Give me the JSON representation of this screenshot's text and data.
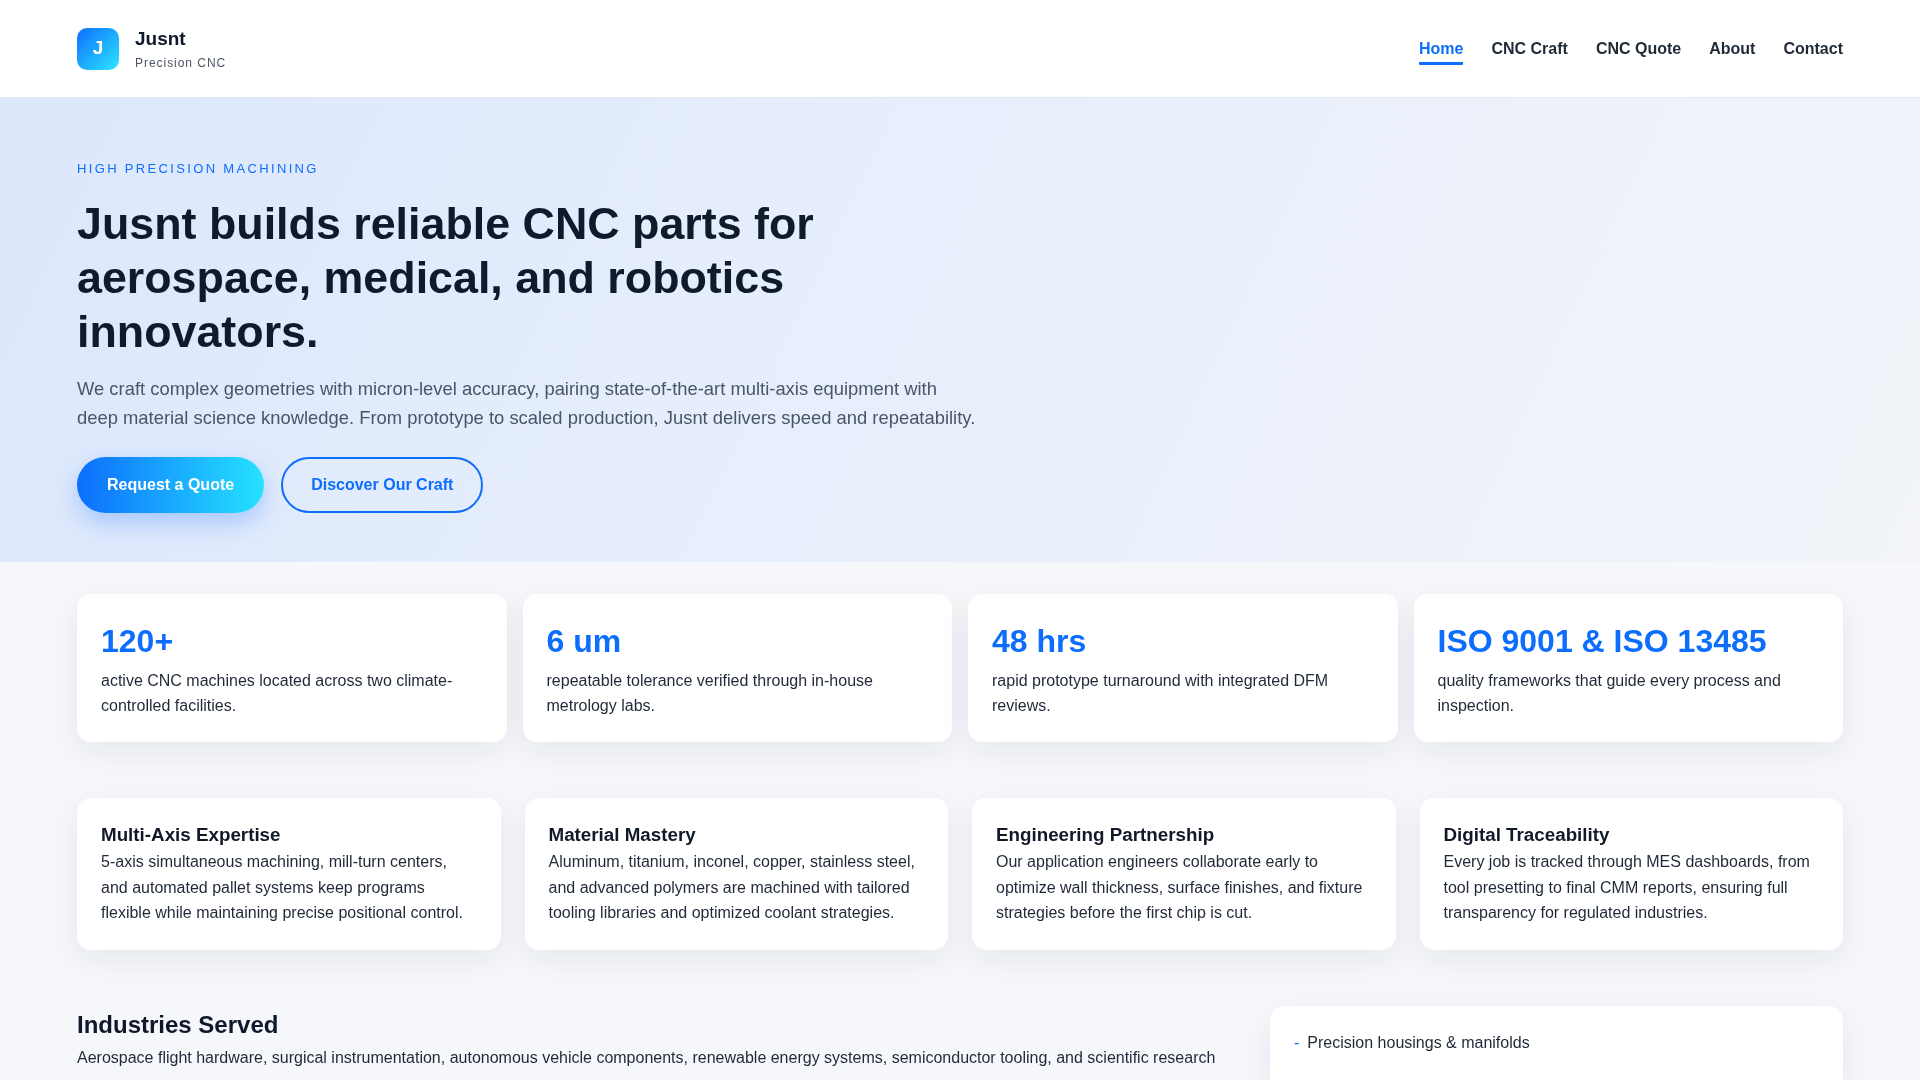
{
  "header": {
    "logo": {
      "letter": "J"
    },
    "brand": "Jusnt",
    "tagline": "Precision CNC",
    "nav": [
      {
        "label": "Home",
        "selected": true
      },
      {
        "label": "CNC Craft",
        "selected": false
      },
      {
        "label": "CNC Quote",
        "selected": false
      },
      {
        "label": "About",
        "selected": false
      },
      {
        "label": "Contact",
        "selected": false
      }
    ]
  },
  "hero": {
    "eyebrow": "HIGH PRECISION MACHINING",
    "title": "Jusnt builds reliable CNC parts for aerospace, medical, and robotics innovators.",
    "text": "We craft complex geometries with micron-level accuracy, pairing state-of-the-art multi-axis equipment with deep material science knowledge. From prototype to scaled production, Jusnt delivers speed and repeatability.",
    "buttons": [
      {
        "label": "Request a Quote",
        "kind": "primary"
      },
      {
        "label": "Discover Our Craft",
        "kind": "outline"
      }
    ]
  },
  "stats": [
    {
      "value": "120+",
      "text": "active CNC machines located across two climate-controlled facilities."
    },
    {
      "value": "6 um",
      "text": "repeatable tolerance verified through in-house metrology labs."
    },
    {
      "value": "48 hrs",
      "text": "rapid prototype turnaround with integrated DFM reviews."
    },
    {
      "value": "ISO 9001 & ISO 13485",
      "text": "quality frameworks that guide every process and inspection."
    }
  ],
  "features": [
    {
      "title": "Multi-Axis Expertise",
      "text": "5-axis simultaneous machining, mill-turn centers, and automated pallet systems keep programs flexible while maintaining precise positional control."
    },
    {
      "title": "Material Mastery",
      "text": "Aluminum, titanium, inconel, copper, stainless steel, and advanced polymers are machined with tailored tooling libraries and optimized coolant strategies."
    },
    {
      "title": "Engineering Partnership",
      "text": "Our application engineers collaborate early to optimize wall thickness, surface finishes, and fixture strategies before the first chip is cut."
    },
    {
      "title": "Digital Traceability",
      "text": "Every job is tracked through MES dashboards, from tool presetting to final CMM reports, ensuring full transparency for regulated industries."
    }
  ],
  "industries": {
    "title": "Industries Served",
    "text": "Aerospace flight hardware, surgical instrumentation, autonomous vehicle components, renewable energy systems, semiconductor tooling, and scientific research",
    "items": [
      {
        "marker": "-",
        "text": "Precision housings & manifolds"
      }
    ]
  }
}
